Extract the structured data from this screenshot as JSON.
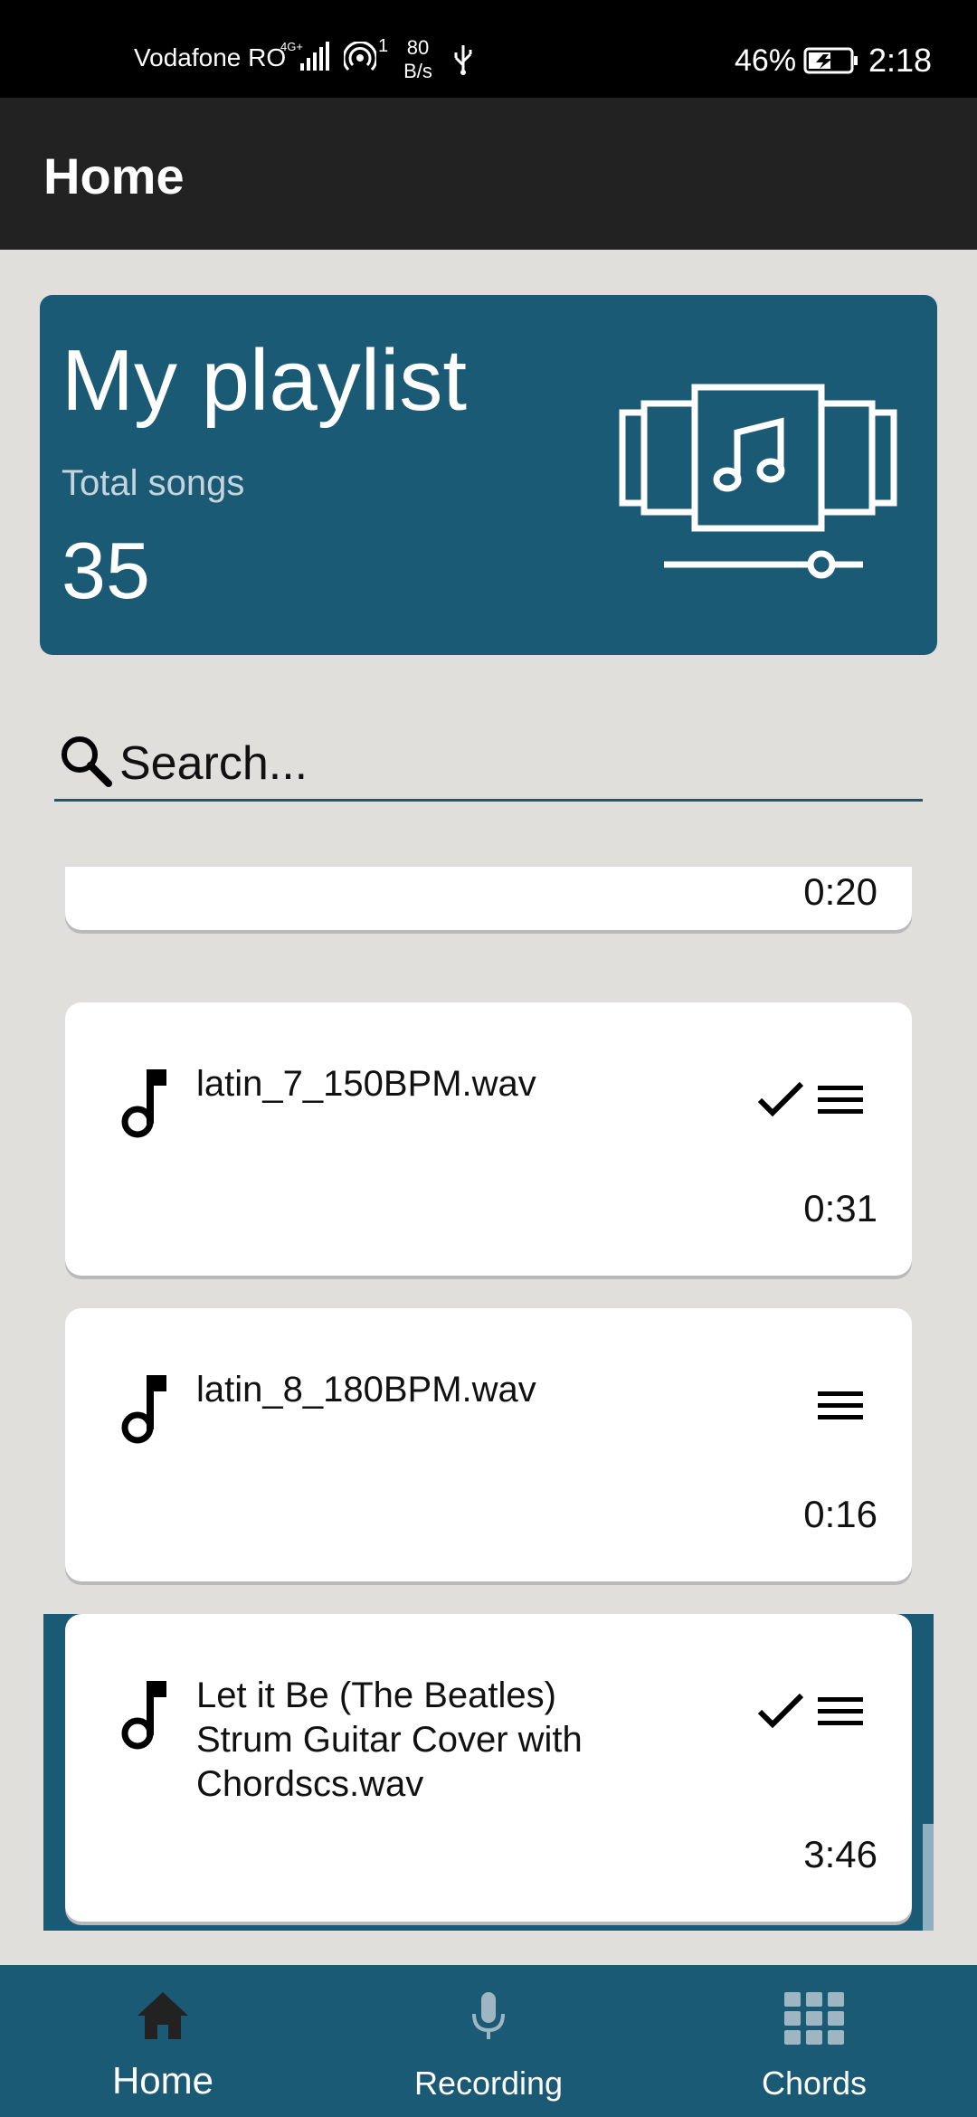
{
  "status_bar": {
    "carrier": "Vodafone RO",
    "network_type": "4G+",
    "hotspot_count": "1",
    "speed_value": "80",
    "speed_unit": "B/s",
    "battery_percent": "46%",
    "time": "2:18"
  },
  "app_bar": {
    "title": "Home"
  },
  "playlist": {
    "title": "My playlist",
    "subtitle": "Total songs",
    "count": "35",
    "art_icon": "music-cassette-icon"
  },
  "search": {
    "placeholder": "Search...",
    "value": ""
  },
  "songs": [
    {
      "name": "",
      "duration": "0:20",
      "checked": false
    },
    {
      "name": "latin_7_150BPM.wav",
      "duration": "0:31",
      "checked": true
    },
    {
      "name": "latin_8_180BPM.wav",
      "duration": "0:16",
      "checked": false
    },
    {
      "name": "Let it Be (The Beatles) Strum Guitar Cover with Chordscs.wav",
      "duration": "3:46",
      "checked": true,
      "active": true
    }
  ],
  "bottom_nav": {
    "items": [
      {
        "label": "Home",
        "icon": "home-icon",
        "active": true
      },
      {
        "label": "Recording",
        "icon": "microphone-icon",
        "active": false
      },
      {
        "label": "Chords",
        "icon": "grid-icon",
        "active": false
      }
    ]
  },
  "colors": {
    "primary": "#1b5a75",
    "app_bar": "#222222",
    "background": "#e0dfdb",
    "status_bar": "#000000"
  }
}
